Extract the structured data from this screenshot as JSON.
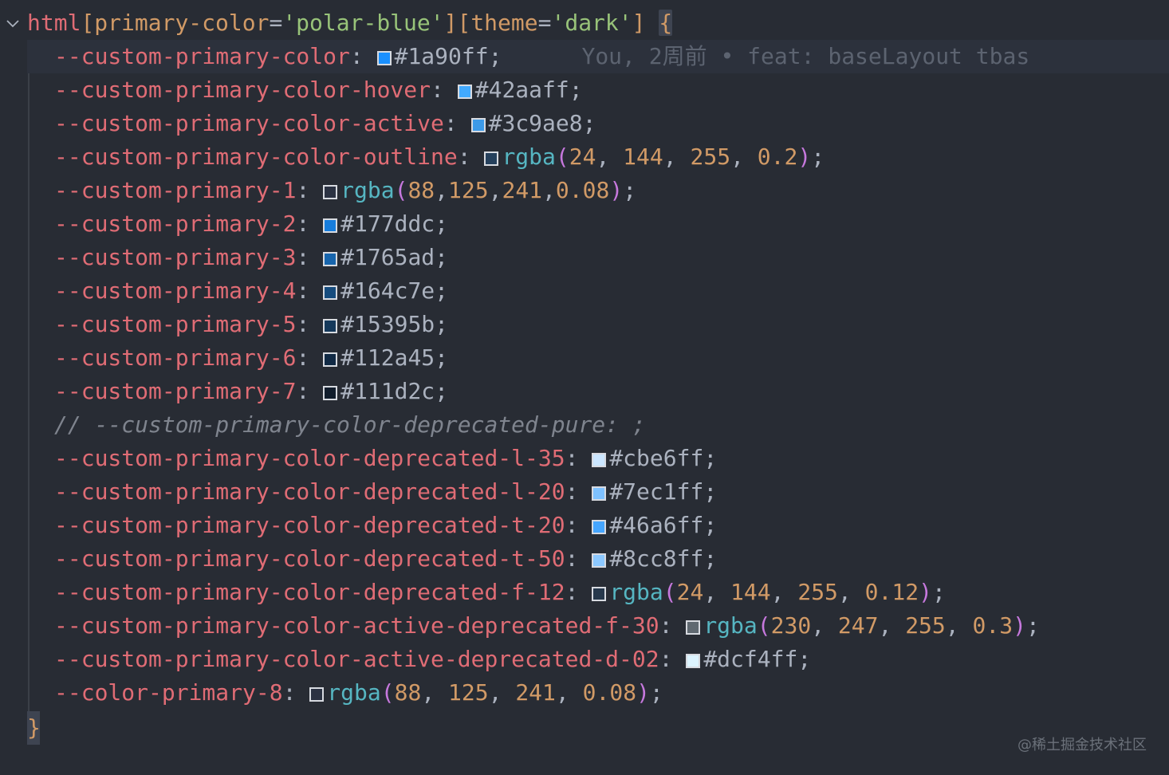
{
  "selector": {
    "element": "html",
    "attr1_open": "[",
    "attr1_name": "primary-color",
    "attr1_eq": "=",
    "attr1_value": "'polar-blue'",
    "attr1_close": "]",
    "attr2_open": "[",
    "attr2_name": "theme",
    "attr2_eq": "=",
    "attr2_value": "'dark'",
    "attr2_close": "]",
    "open_brace": "{"
  },
  "blame": "You, 2周前 • feat: baseLayout tbas",
  "lines": [
    {
      "prop": "--custom-primary-color",
      "swatch": "#1a90ff",
      "value": "#1a90ff"
    },
    {
      "prop": "--custom-primary-color-hover",
      "swatch": "#42aaff",
      "value": "#42aaff"
    },
    {
      "prop": "--custom-primary-color-active",
      "swatch": "#3c9ae8",
      "value": "#3c9ae8"
    },
    {
      "prop": "--custom-primary-color-outline",
      "swatch": "rgba(24,144,255,0.2)",
      "func": "rgba",
      "args": [
        "24",
        " 144",
        " 255",
        " 0.2"
      ]
    },
    {
      "prop": "--custom-primary-1",
      "swatch": "rgba(88,125,241,0.08)",
      "func": "rgba",
      "args": [
        "88",
        "125",
        "241",
        "0.08"
      ]
    },
    {
      "prop": "--custom-primary-2",
      "swatch": "#177ddc",
      "value": "#177ddc"
    },
    {
      "prop": "--custom-primary-3",
      "swatch": "#1765ad",
      "value": "#1765ad"
    },
    {
      "prop": "--custom-primary-4",
      "swatch": "#164c7e",
      "value": "#164c7e"
    },
    {
      "prop": "--custom-primary-5",
      "swatch": "#15395b",
      "value": "#15395b"
    },
    {
      "prop": "--custom-primary-6",
      "swatch": "#112a45",
      "value": "#112a45"
    },
    {
      "prop": "--custom-primary-7",
      "swatch": "#111d2c",
      "value": "#111d2c"
    },
    {
      "comment": "// --custom-primary-color-deprecated-pure: ;"
    },
    {
      "prop": "--custom-primary-color-deprecated-l-35",
      "swatch": "#cbe6ff",
      "value": "#cbe6ff"
    },
    {
      "prop": "--custom-primary-color-deprecated-l-20",
      "swatch": "#7ec1ff",
      "value": "#7ec1ff"
    },
    {
      "prop": "--custom-primary-color-deprecated-t-20",
      "swatch": "#46a6ff",
      "value": "#46a6ff"
    },
    {
      "prop": "--custom-primary-color-deprecated-t-50",
      "swatch": "#8cc8ff",
      "value": "#8cc8ff"
    },
    {
      "prop": "--custom-primary-color-deprecated-f-12",
      "swatch": "rgba(24,144,255,0.12)",
      "func": "rgba",
      "args": [
        "24",
        " 144",
        " 255",
        " 0.12"
      ]
    },
    {
      "prop": "--custom-primary-color-active-deprecated-f-30",
      "swatch": "rgba(230,247,255,0.3)",
      "func": "rgba",
      "args": [
        "230",
        " 247",
        " 255",
        " 0.3"
      ]
    },
    {
      "prop": "--custom-primary-color-active-deprecated-d-02",
      "swatch": "#dcf4ff",
      "value": "#dcf4ff"
    },
    {
      "prop": "--color-primary-8",
      "swatch": "rgba(88,125,241,0.08)",
      "func": "rgba",
      "args": [
        "88",
        " 125",
        " 241",
        " 0.08"
      ]
    }
  ],
  "close_brace": "}",
  "watermark": "@稀土掘金技术社区",
  "icons": {
    "fold": "chevron-down-icon"
  }
}
